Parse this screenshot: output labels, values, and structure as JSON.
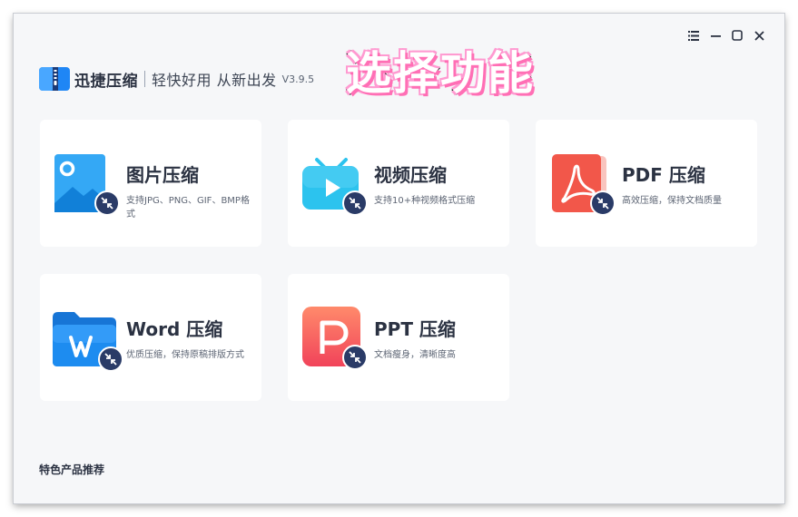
{
  "window": {
    "controls": [
      "menu-icon",
      "minimize-icon",
      "maximize-icon",
      "close-icon"
    ]
  },
  "header": {
    "app_name": "迅捷压缩",
    "slogan": "轻快好用 从新出发",
    "version": "V3.9.5"
  },
  "banner": {
    "title": "选择功能"
  },
  "cards": [
    {
      "title": "图片压缩",
      "desc": "支持JPG、PNG、GIF、BMP格式",
      "icon": "image-icon"
    },
    {
      "title": "视频压缩",
      "desc": "支持10+种视频格式压缩",
      "icon": "video-icon"
    },
    {
      "title": "PDF 压缩",
      "desc": "高效压缩，保持文档质量",
      "icon": "pdf-icon"
    },
    {
      "title": "Word 压缩",
      "desc": "优质压缩，保持原稿排版方式",
      "icon": "word-icon"
    },
    {
      "title": "PPT 压缩",
      "desc": "文档瘦身，清晰度高",
      "icon": "ppt-icon"
    }
  ],
  "footer": {
    "title": "特色产品推荐"
  },
  "colors": {
    "image": "#1f9cf0",
    "video": "#2cc3ee",
    "pdf": "#f2574a",
    "word": "#1d8cf0",
    "ppt": "#f5524f",
    "compress_badge": "#2a3b67",
    "text_dark": "#2b3242"
  }
}
